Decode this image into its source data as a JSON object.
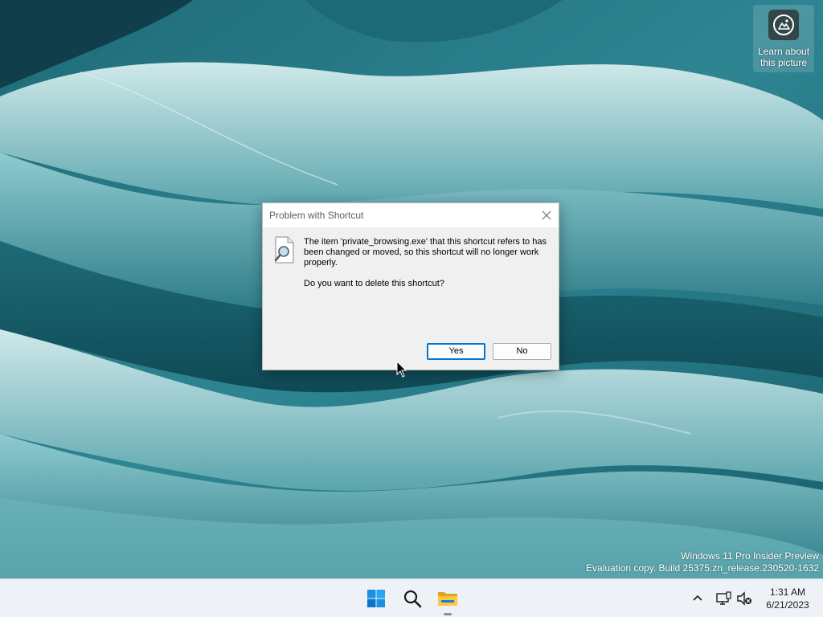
{
  "desktop": {
    "learn_widget": {
      "label_line1": "Learn about",
      "label_line2": "this picture"
    },
    "watermark": {
      "line1": "Windows 11 Pro Insider Preview",
      "line2": "Evaluation copy. Build 25375.zn_release.230520-1632"
    }
  },
  "dialog": {
    "title": "Problem with Shortcut",
    "message": "The item 'private_browsing.exe' that this shortcut refers to has been changed or moved, so this shortcut will no longer work properly.",
    "question": "Do you want to delete this shortcut?",
    "yes_label": "Yes",
    "no_label": "No",
    "icon": "shortcut-search-icon"
  },
  "taskbar": {
    "apps": [
      {
        "name": "Start",
        "icon": "windows-logo-icon"
      },
      {
        "name": "Search",
        "icon": "search-icon"
      },
      {
        "name": "File Explorer",
        "icon": "folder-icon"
      }
    ],
    "tray": {
      "chevron_icon": "chevron-up-icon",
      "network_icon": "network-icon",
      "volume_icon": "volume-muted-icon"
    },
    "clock": {
      "time": "1:31 AM",
      "date": "6/21/2023"
    }
  },
  "colors": {
    "accent": "#0078d4",
    "taskbar_bg": "#eef1f5",
    "dialog_bg": "#f0f0f0"
  }
}
